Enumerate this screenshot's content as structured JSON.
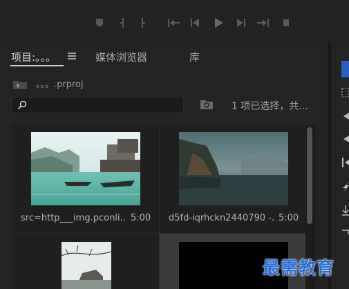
{
  "transport": {
    "buttons": [
      "marker-button",
      "mark-in-button",
      "mark-out-button",
      "go-to-in-button",
      "step-back-button",
      "play-button",
      "step-forward-button",
      "go-to-out-button"
    ]
  },
  "tabs": [
    {
      "label": "项目:。。。"
    },
    {
      "label": "媒体浏览器"
    },
    {
      "label": "库"
    }
  ],
  "project": {
    "path": "。。。.prproj",
    "search_placeholder": "",
    "status": "1 项已选择，共..."
  },
  "clips": [
    {
      "name": "src=http___img.pconli...",
      "duration": "5:00"
    },
    {
      "name": "d5fd-iqrhckn2440790 -...",
      "duration": "5:00"
    },
    {
      "name": "",
      "duration": ""
    },
    {
      "name": "",
      "duration": ""
    }
  ],
  "selected_clip_index": 3,
  "watermark": "最需教育",
  "colors": {
    "background": "#1a1a1a",
    "panel": "#232323",
    "accent": "#2b6fd6"
  }
}
